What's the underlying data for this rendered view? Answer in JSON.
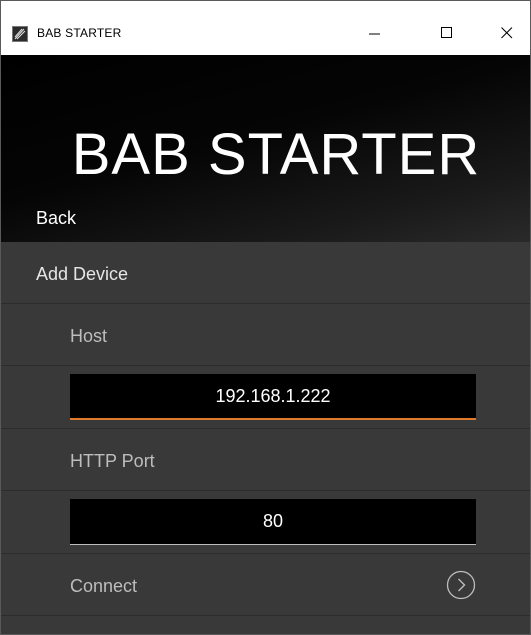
{
  "window": {
    "title": "BAB STARTER",
    "app_icon": "app-icon",
    "controls": {
      "minimize_icon": "minimize-icon",
      "maximize_icon": "maximize-icon",
      "close_icon": "close-icon"
    }
  },
  "header": {
    "brand": "BAB STARTER",
    "back_label": "Back"
  },
  "form": {
    "section_title": "Add Device",
    "host_label": "Host",
    "host_value": "192.168.1.222",
    "port_label": "HTTP Port",
    "port_value": "80",
    "connect_label": "Connect",
    "connect_icon": "chevron-right-circle-icon"
  },
  "colors": {
    "accent": "#e07b2e",
    "background": "#393939",
    "header_background": "#000000",
    "field_background": "#000000"
  }
}
